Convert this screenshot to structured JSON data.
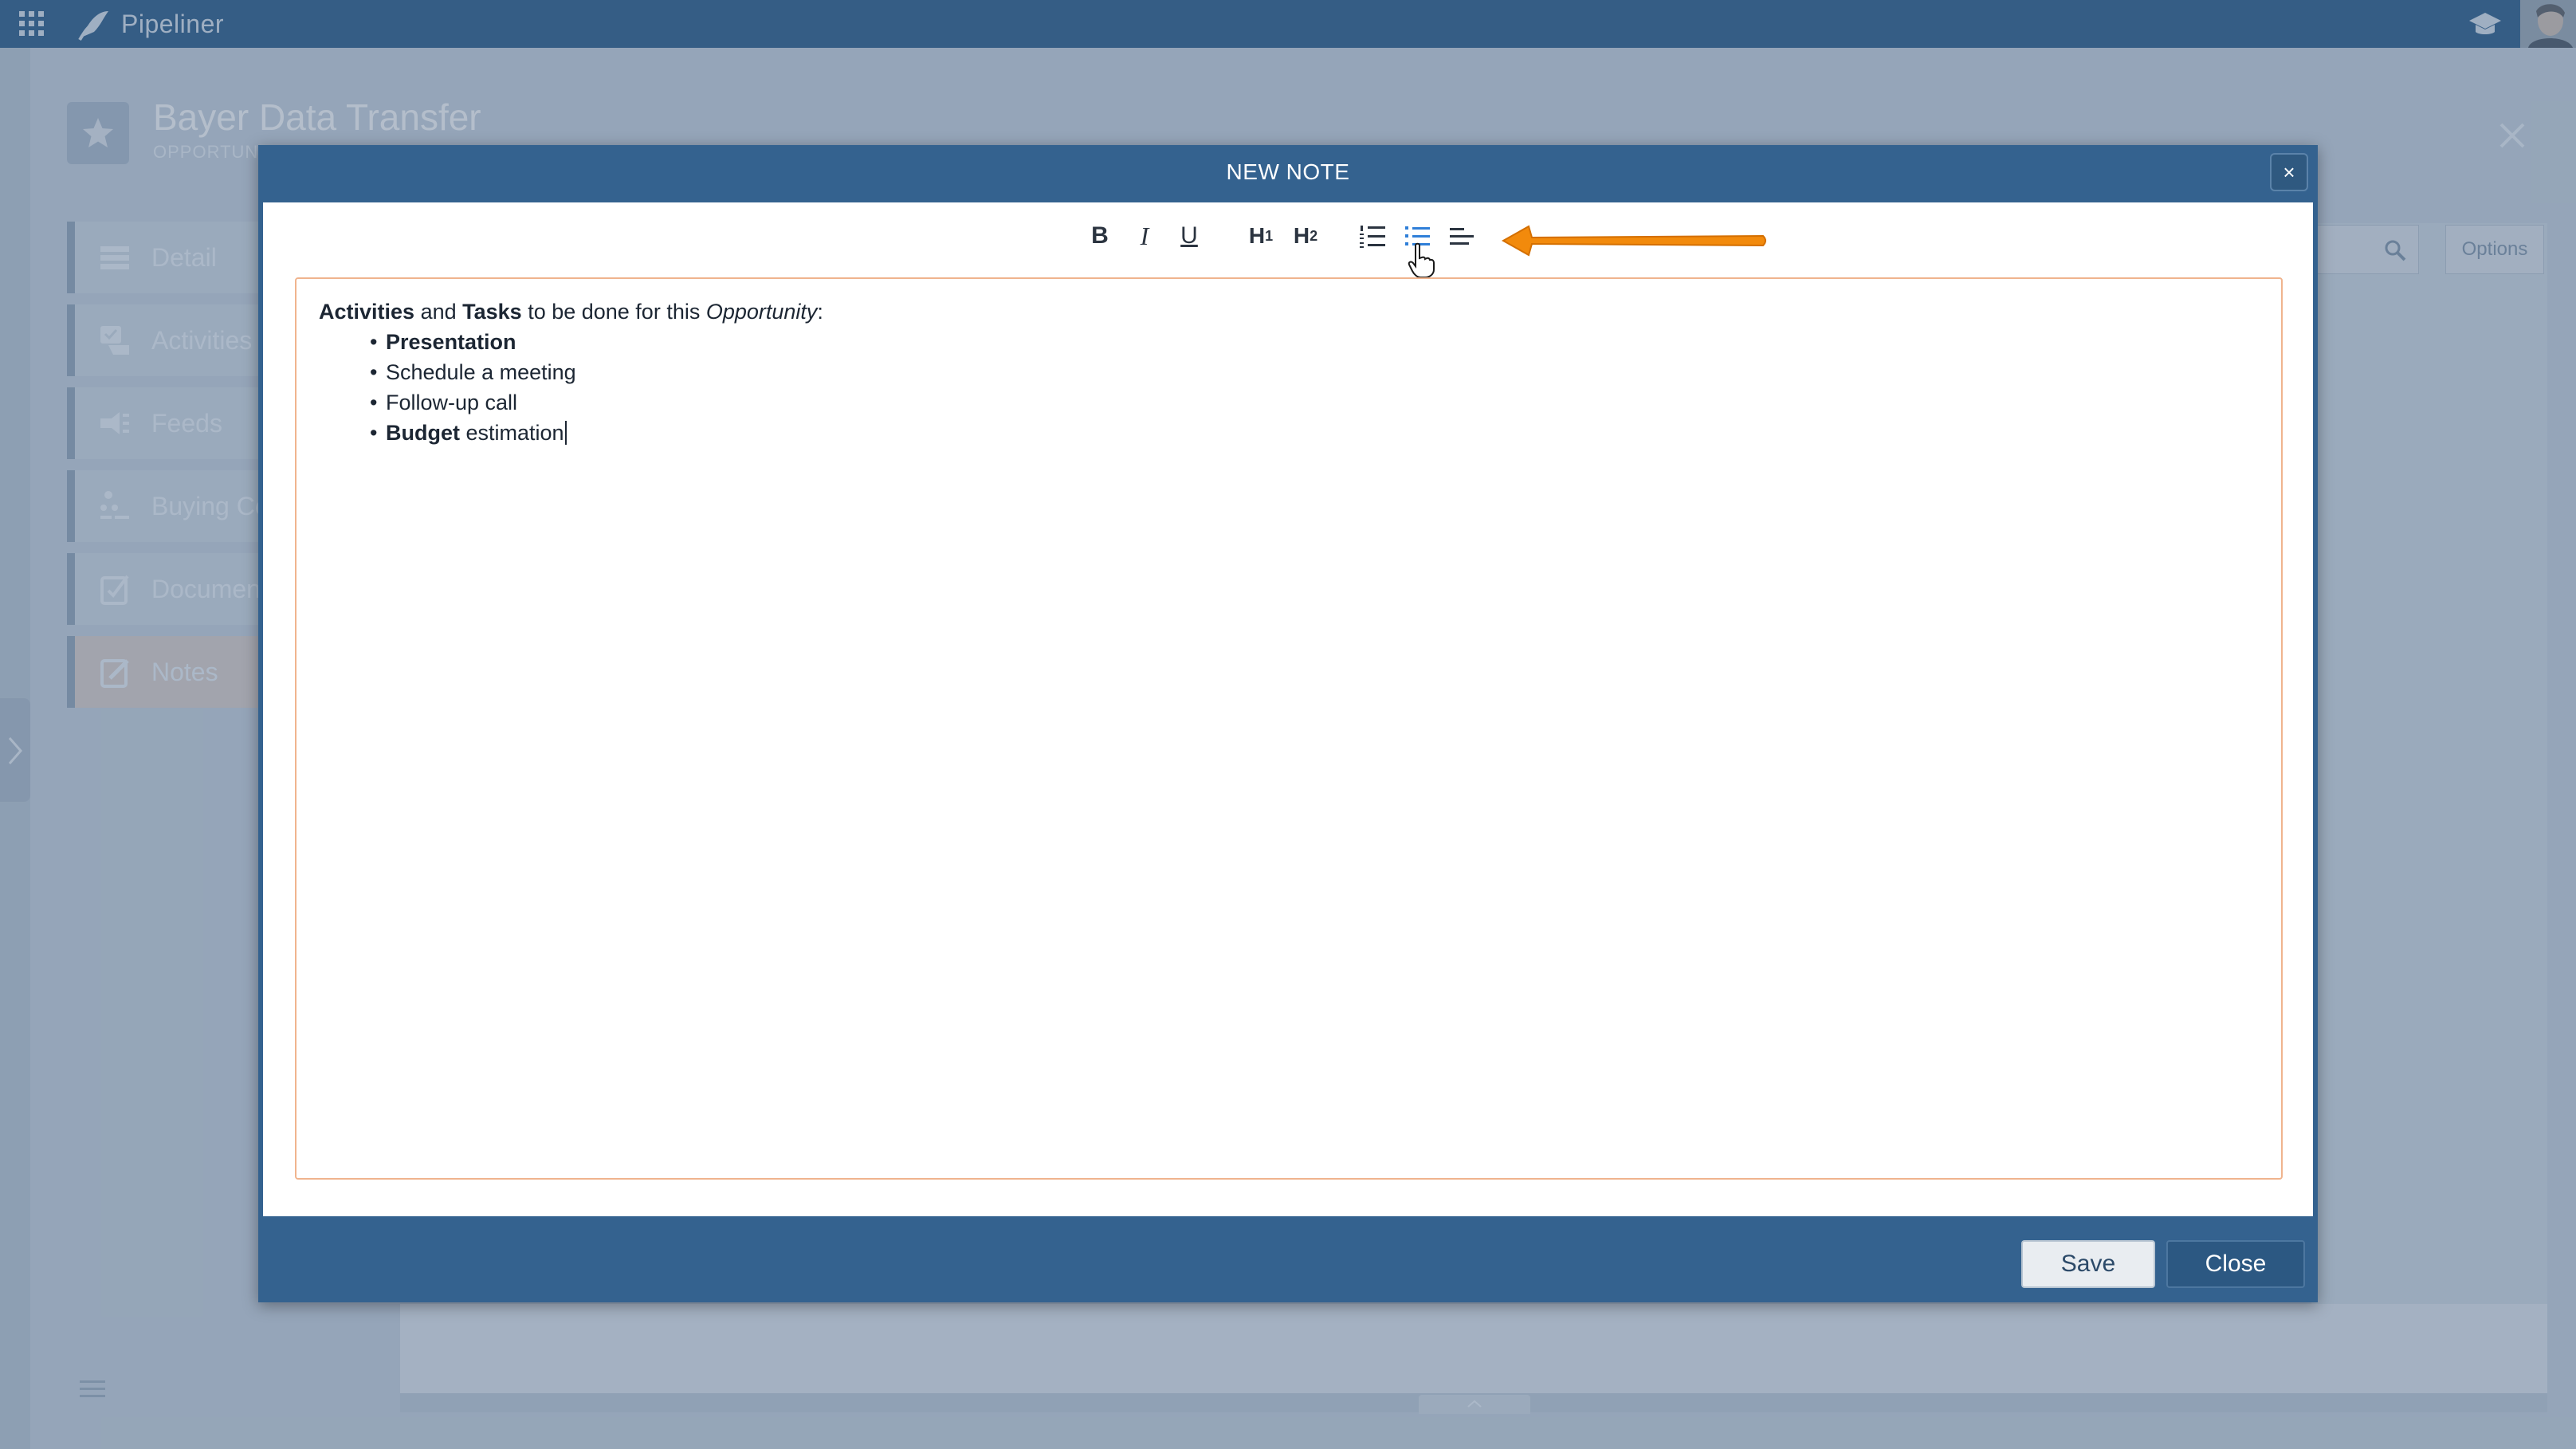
{
  "app": {
    "name": "Pipeliner"
  },
  "header": {
    "icons": [
      "apps-grid-icon",
      "graduation-cap-icon",
      "user-avatar"
    ]
  },
  "record": {
    "title": "Bayer Data Transfer",
    "subtitle": "OPPORTUNITY"
  },
  "sidebar": {
    "items": [
      {
        "label": "Detail",
        "icon": "list-icon",
        "accent": "#b8a98e"
      },
      {
        "label": "Activities",
        "icon": "activities-icon",
        "accent": "#b88f8f"
      },
      {
        "label": "Feeds",
        "icon": "feeds-icon",
        "accent": "#c19a8a"
      },
      {
        "label": "Buying Center",
        "icon": "buying-center-icon",
        "accent": "#8fb39a"
      },
      {
        "label": "Documents",
        "icon": "documents-icon",
        "accent": "#7fb2ad"
      },
      {
        "label": "Notes",
        "icon": "notes-icon",
        "accent": "#e0a88a",
        "active": true
      }
    ]
  },
  "background_panel": {
    "options_label": "Options"
  },
  "modal": {
    "title": "NEW NOTE",
    "close_x": "×",
    "toolbar": {
      "bold": "B",
      "italic": "I",
      "underline": "U",
      "h1": "H",
      "h1_sub": "1",
      "h2": "H",
      "h2_sub": "2",
      "ordered_list": "ordered-list-icon",
      "bullet_list": "bullet-list-icon",
      "align": "align-left-icon",
      "active": "bullet_list"
    },
    "note": {
      "intro": {
        "part1": "Activities",
        "part2": " and ",
        "part3": "Tasks",
        "part4": " to be done for this ",
        "part5": "Opportunity",
        "part6": ":"
      },
      "bullets": [
        {
          "bold": "Presentation",
          "text": ""
        },
        {
          "bold": "",
          "text": "Schedule a meeting"
        },
        {
          "bold": "",
          "text": "Follow-up call"
        },
        {
          "bold": "Budget",
          "text": " estimation"
        }
      ]
    },
    "footer": {
      "save_label": "Save",
      "close_label": "Close"
    }
  },
  "colors": {
    "topbar": "#3c6a94",
    "modal": "#34628f",
    "editor_border": "#f0b48e",
    "active_tool": "#2f7fd8",
    "arrow": "#f28a0c"
  }
}
